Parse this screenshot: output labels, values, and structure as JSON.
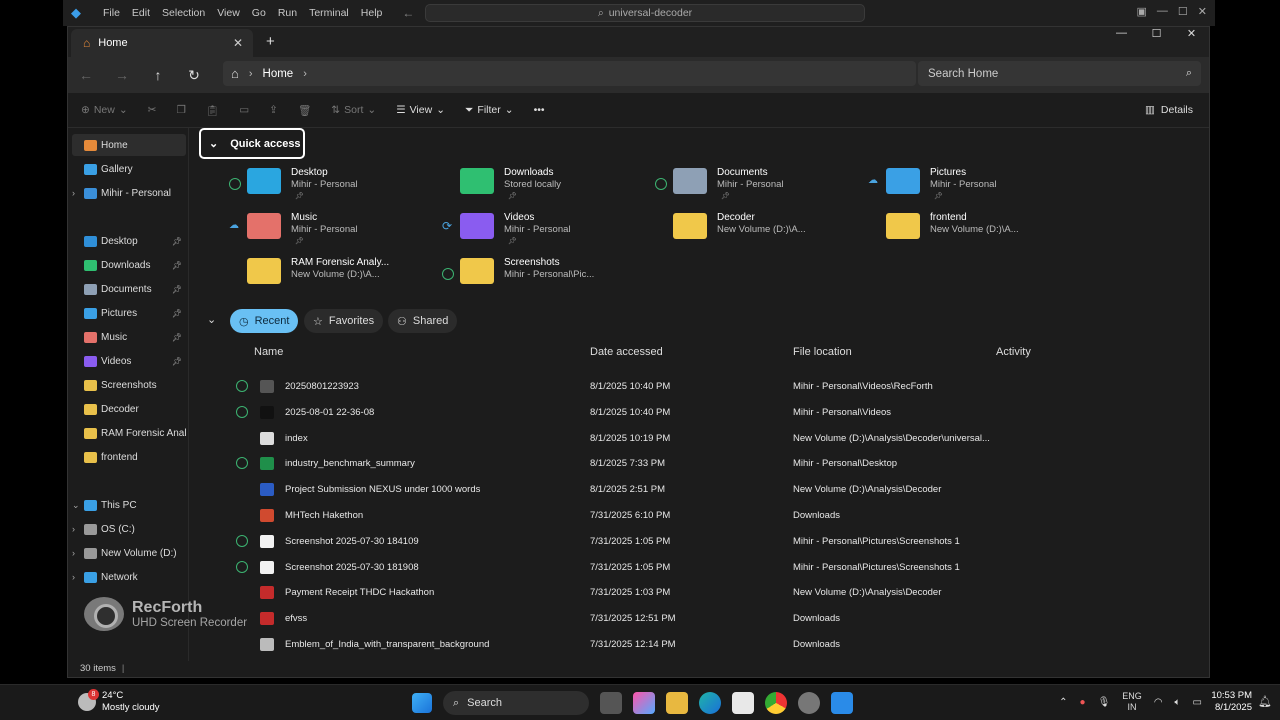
{
  "vscode": {
    "menu": [
      "File",
      "Edit",
      "Selection",
      "View",
      "Go",
      "Run",
      "Terminal",
      "Help"
    ],
    "command_center": "universal-decoder"
  },
  "explorer": {
    "tab_title": "Home",
    "window_controls": [
      "—",
      "☐",
      "✕"
    ],
    "breadcrumb": [
      "Home"
    ],
    "search_placeholder": "Search Home",
    "toolbar": {
      "new": "New",
      "sort": "Sort",
      "view": "View",
      "filter": "Filter",
      "more": "•••",
      "details": "Details"
    },
    "sidebar": {
      "top": [
        {
          "label": "Home",
          "color": "#e58a3a"
        },
        {
          "label": "Gallery",
          "color": "#3aa0e5"
        },
        {
          "label": "Mihir - Personal",
          "color": "#3a8fd9"
        }
      ],
      "pinned": [
        {
          "label": "Desktop",
          "color": "#2f8fd8"
        },
        {
          "label": "Downloads",
          "color": "#2fbf71"
        },
        {
          "label": "Documents",
          "color": "#8ea0b5"
        },
        {
          "label": "Pictures",
          "color": "#3aa0e5"
        },
        {
          "label": "Music",
          "color": "#e4716a"
        },
        {
          "label": "Videos",
          "color": "#8a5cf0"
        },
        {
          "label": "Screenshots",
          "color": "#e8c04a"
        },
        {
          "label": "Decoder",
          "color": "#e8c04a"
        },
        {
          "label": "RAM Forensic Analy",
          "color": "#e8c04a"
        },
        {
          "label": "frontend",
          "color": "#e8c04a"
        }
      ],
      "bottom": [
        {
          "label": "This PC",
          "color": "#3aa0e5"
        },
        {
          "label": "OS (C:)",
          "color": "#999999"
        },
        {
          "label": "New Volume (D:)",
          "color": "#999999"
        },
        {
          "label": "Network",
          "color": "#3aa0e5"
        }
      ]
    },
    "quick_access": {
      "header": "Quick access",
      "items": [
        {
          "name": "Desktop",
          "sub": "Mihir - Personal",
          "status": "check",
          "color": "#2aa6e0",
          "pinned": true
        },
        {
          "name": "Downloads",
          "sub": "Stored locally",
          "status": "",
          "color": "#2fbf71",
          "pinned": true
        },
        {
          "name": "Documents",
          "sub": "Mihir - Personal",
          "status": "check",
          "color": "#8ea0b5",
          "pinned": true
        },
        {
          "name": "Pictures",
          "sub": "Mihir - Personal",
          "status": "cloud",
          "color": "#3aa0e5",
          "pinned": true
        },
        {
          "name": "Music",
          "sub": "Mihir - Personal",
          "status": "cloud",
          "color": "#e4716a",
          "pinned": true
        },
        {
          "name": "Videos",
          "sub": "Mihir - Personal",
          "status": "sync",
          "color": "#8a5cf0",
          "pinned": true
        },
        {
          "name": "Decoder",
          "sub": "New Volume (D:)\\A...",
          "status": "",
          "color": "#f0c84a",
          "pinned": false
        },
        {
          "name": "frontend",
          "sub": "New Volume (D:)\\A...",
          "status": "",
          "color": "#f0c84a",
          "pinned": false
        },
        {
          "name": "RAM Forensic Analy...",
          "sub": "New Volume (D:)\\A...",
          "status": "",
          "color": "#f0c84a",
          "pinned": false
        },
        {
          "name": "Screenshots",
          "sub": "Mihir - Personal\\Pic...",
          "status": "check",
          "color": "#f0c84a",
          "pinned": false
        }
      ]
    },
    "filter_tabs": [
      "Recent",
      "Favorites",
      "Shared"
    ],
    "columns": [
      "Name",
      "Date accessed",
      "File location",
      "Activity"
    ],
    "files": [
      {
        "name": "20250801223923",
        "date": "8/1/2025 10:40 PM",
        "location": "Mihir - Personal\\Videos\\RecForth",
        "synced": true,
        "color": "#555555"
      },
      {
        "name": "2025-08-01 22-36-08",
        "date": "8/1/2025 10:40 PM",
        "location": "Mihir - Personal\\Videos",
        "synced": true,
        "color": "#111111"
      },
      {
        "name": "index",
        "date": "8/1/2025 10:19 PM",
        "location": "New Volume (D:)\\Analysis\\Decoder\\universal...",
        "synced": false,
        "color": "#dddddd"
      },
      {
        "name": "industry_benchmark_summary",
        "date": "8/1/2025 7:33 PM",
        "location": "Mihir - Personal\\Desktop",
        "synced": true,
        "color": "#1f8f4a"
      },
      {
        "name": "Project Submission NEXUS under 1000 words",
        "date": "8/1/2025 2:51 PM",
        "location": "New Volume (D:)\\Analysis\\Decoder",
        "synced": false,
        "color": "#2b5cc4"
      },
      {
        "name": "MHTech Hakethon",
        "date": "7/31/2025 6:10 PM",
        "location": "Downloads",
        "synced": false,
        "color": "#d04a2f"
      },
      {
        "name": "Screenshot 2025-07-30 184109",
        "date": "7/31/2025 1:05 PM",
        "location": "Mihir - Personal\\Pictures\\Screenshots 1",
        "synced": true,
        "color": "#f2f2f2"
      },
      {
        "name": "Screenshot 2025-07-30 181908",
        "date": "7/31/2025 1:05 PM",
        "location": "Mihir - Personal\\Pictures\\Screenshots 1",
        "synced": true,
        "color": "#f2f2f2"
      },
      {
        "name": "Payment Receipt THDC Hackathon",
        "date": "7/31/2025 1:03 PM",
        "location": "New Volume (D:)\\Analysis\\Decoder",
        "synced": false,
        "color": "#c42b2b"
      },
      {
        "name": "efvss",
        "date": "7/31/2025 12:51 PM",
        "location": "Downloads",
        "synced": false,
        "color": "#c42b2b"
      },
      {
        "name": "Emblem_of_India_with_transparent_background",
        "date": "7/31/2025 12:14 PM",
        "location": "Downloads",
        "synced": false,
        "color": "#bbbbbb"
      }
    ],
    "status": "30 items"
  },
  "watermark": {
    "brand": "RecForth",
    "tagline": "UHD Screen Recorder"
  },
  "taskbar": {
    "weather_temp": "24°C",
    "weather_desc": "Mostly cloudy",
    "weather_badge": "8",
    "search_label": "Search",
    "lang_1": "ENG",
    "lang_2": "IN",
    "time": "10:53 PM",
    "date": "8/1/2025"
  }
}
